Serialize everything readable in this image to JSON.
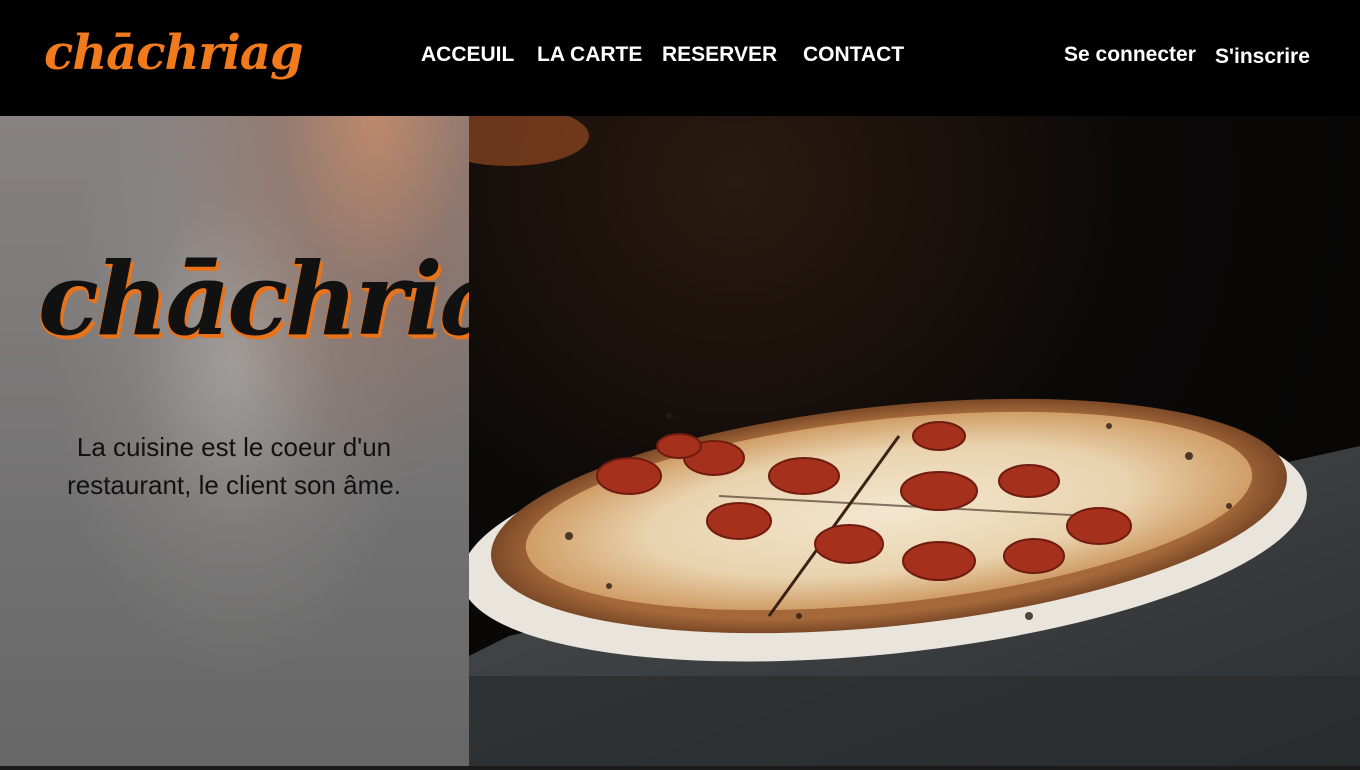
{
  "brand": {
    "logo_text": "chāchriag"
  },
  "nav": {
    "items": [
      {
        "label": "ACCEUIL"
      },
      {
        "label": "LA CARTE"
      },
      {
        "label": "RESERVER"
      },
      {
        "label": "CONTACT"
      }
    ]
  },
  "auth": {
    "login_label": "Se connecter",
    "signup_label": "S'inscrire"
  },
  "hero": {
    "logo_text": "chāchriag",
    "tagline": "La cuisine est le coeur d'un restaurant, le client son âme.",
    "image": "pizza-photo"
  },
  "colors": {
    "accent": "#f07a1c",
    "header_bg": "#000000"
  }
}
